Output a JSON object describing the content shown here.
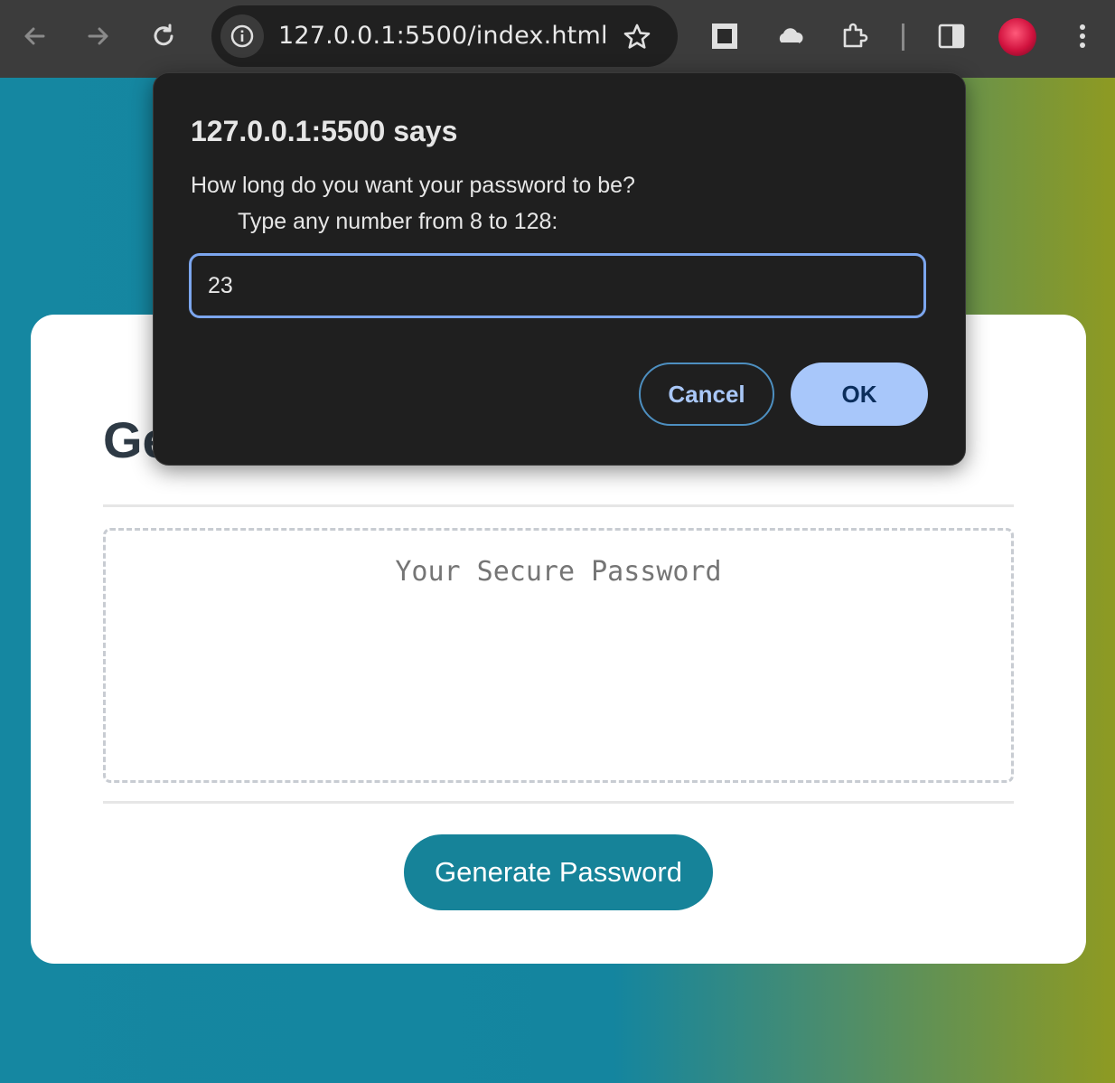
{
  "browser": {
    "url": "127.0.0.1:5500/index.html",
    "icons": [
      "back-arrow-icon",
      "forward-arrow-icon",
      "reload-icon",
      "site-info-icon",
      "bookmark-star-icon",
      "extension-square-icon",
      "cloud-icon",
      "puzzle-extensions-icon",
      "side-panel-icon",
      "profile-avatar",
      "more-menu-icon"
    ]
  },
  "page": {
    "title_visible": "Ge",
    "password_placeholder": "Your Secure Password",
    "generate_button": "Generate Password"
  },
  "dialog": {
    "title": "127.0.0.1:5500 says",
    "message_line1": "How long do you want your password to be?",
    "message_line2": "Type any number from 8 to 128:",
    "input_value": "23",
    "cancel_label": "Cancel",
    "ok_label": "OK"
  },
  "colors": {
    "toolbar": "#3c3c3c",
    "dialog_bg": "#1f1f1f",
    "accent_blue": "#a8c7fa",
    "generate_button": "#168399"
  }
}
